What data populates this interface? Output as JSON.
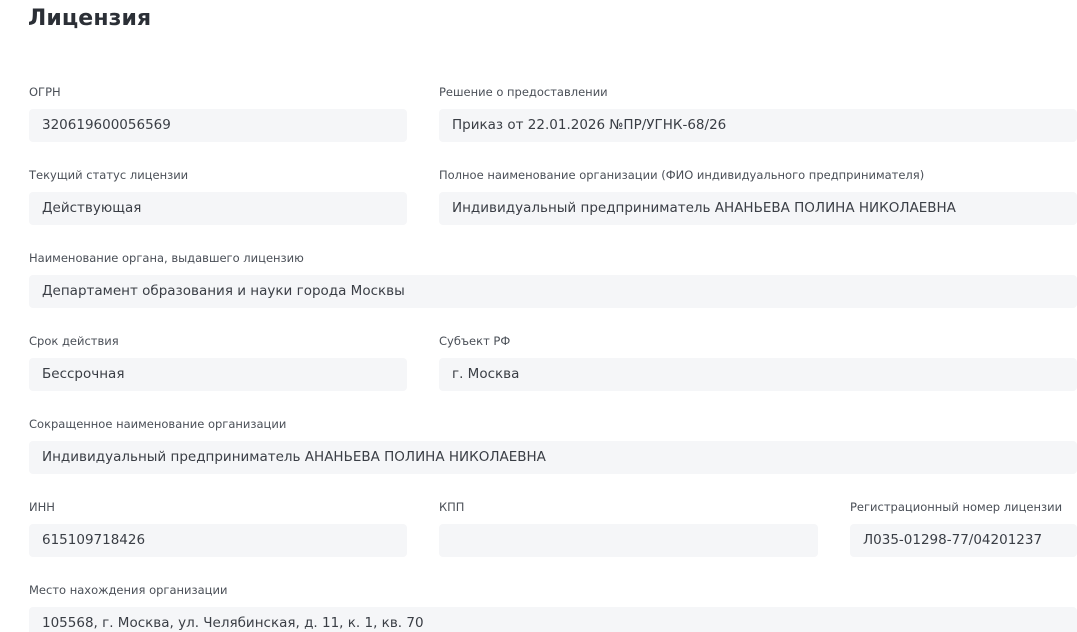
{
  "header": {
    "title": "Лицензия"
  },
  "fields": {
    "ogrn": {
      "label": "ОГРН",
      "value": "320619600056569"
    },
    "decision": {
      "label": "Решение о предоставлении",
      "value": "Приказ от 22.01.2026 №ПР/УГНК-68/26"
    },
    "status": {
      "label": "Текущий статус лицензии",
      "value": "Действующая"
    },
    "full_name": {
      "label": "Полное наименование организации (ФИО индивидуального предпринимателя)",
      "value": "Индивидуальный предприниматель АНАНЬЕВА ПОЛИНА НИКОЛАЕВНА"
    },
    "issuer": {
      "label": "Наименование органа, выдавшего лицензию",
      "value": "Департамент образования и науки города Москвы"
    },
    "validity": {
      "label": "Срок действия",
      "value": "Бессрочная"
    },
    "region": {
      "label": "Субъект РФ",
      "value": "г. Москва"
    },
    "short_name": {
      "label": "Сокращенное наименование организации",
      "value": "Индивидуальный предприниматель АНАНЬЕВА ПОЛИНА НИКОЛАЕВНА"
    },
    "inn": {
      "label": "ИНН",
      "value": "615109718426"
    },
    "kpp": {
      "label": "КПП",
      "value": ""
    },
    "reg_number": {
      "label": "Регистрационный номер лицензии",
      "value": "Л035-01298-77/04201237"
    },
    "address": {
      "label": "Место нахождения организации",
      "value": "105568, г. Москва, ул. Челябинская, д. 11, к. 1, кв. 70"
    }
  }
}
